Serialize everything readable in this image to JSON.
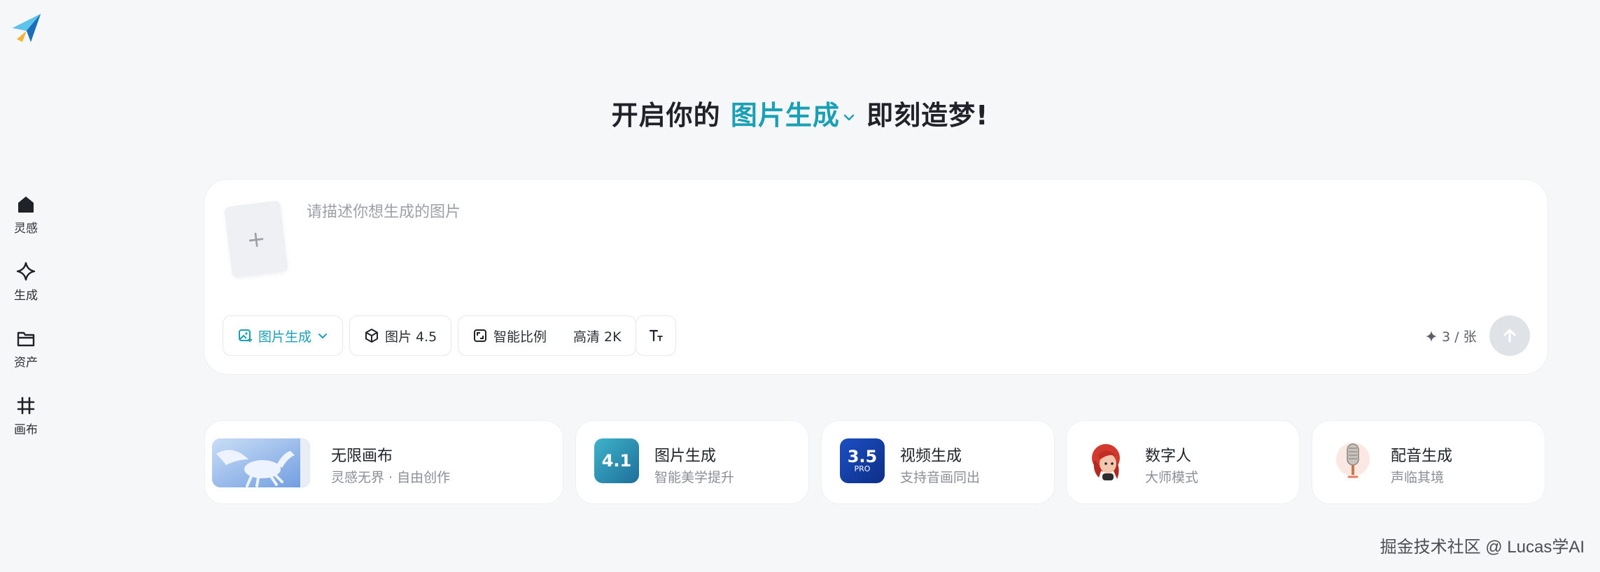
{
  "brand": {
    "logo_icon": "paper-plane-logo-icon"
  },
  "sidebar": {
    "items": [
      {
        "label": "灵感",
        "icon": "home-icon"
      },
      {
        "label": "生成",
        "icon": "sparkle-diamond-icon"
      },
      {
        "label": "资产",
        "icon": "folder-icon"
      },
      {
        "label": "画布",
        "icon": "grid-hash-icon"
      }
    ]
  },
  "headline": {
    "prefix": "开启你的",
    "mode": "图片生成",
    "suffix": "即刻造梦!"
  },
  "prompt": {
    "placeholder": "请描述你想生成的图片",
    "value": "",
    "upload_icon": "plus-icon",
    "chips": {
      "mode": "图片生成",
      "model": "图片 4.5",
      "ratio": "智能比例",
      "quality": "高清 2K"
    },
    "credits": "3 / 张"
  },
  "features": [
    {
      "title": "无限画布",
      "subtitle": "灵感无界 · 自由创作"
    },
    {
      "title": "图片生成",
      "subtitle": "智能美学提升",
      "badge": "4.1"
    },
    {
      "title": "视频生成",
      "subtitle": "支持音画同出",
      "badge": "3.5",
      "badge_sub": "PRO"
    },
    {
      "title": "数字人",
      "subtitle": "大师模式"
    },
    {
      "title": "配音生成",
      "subtitle": "声临其境"
    }
  ],
  "watermark": "掘金技术社区 @ Lucas学AI",
  "colors": {
    "accent": "#1aa0b4",
    "background": "#f6f7f9"
  }
}
